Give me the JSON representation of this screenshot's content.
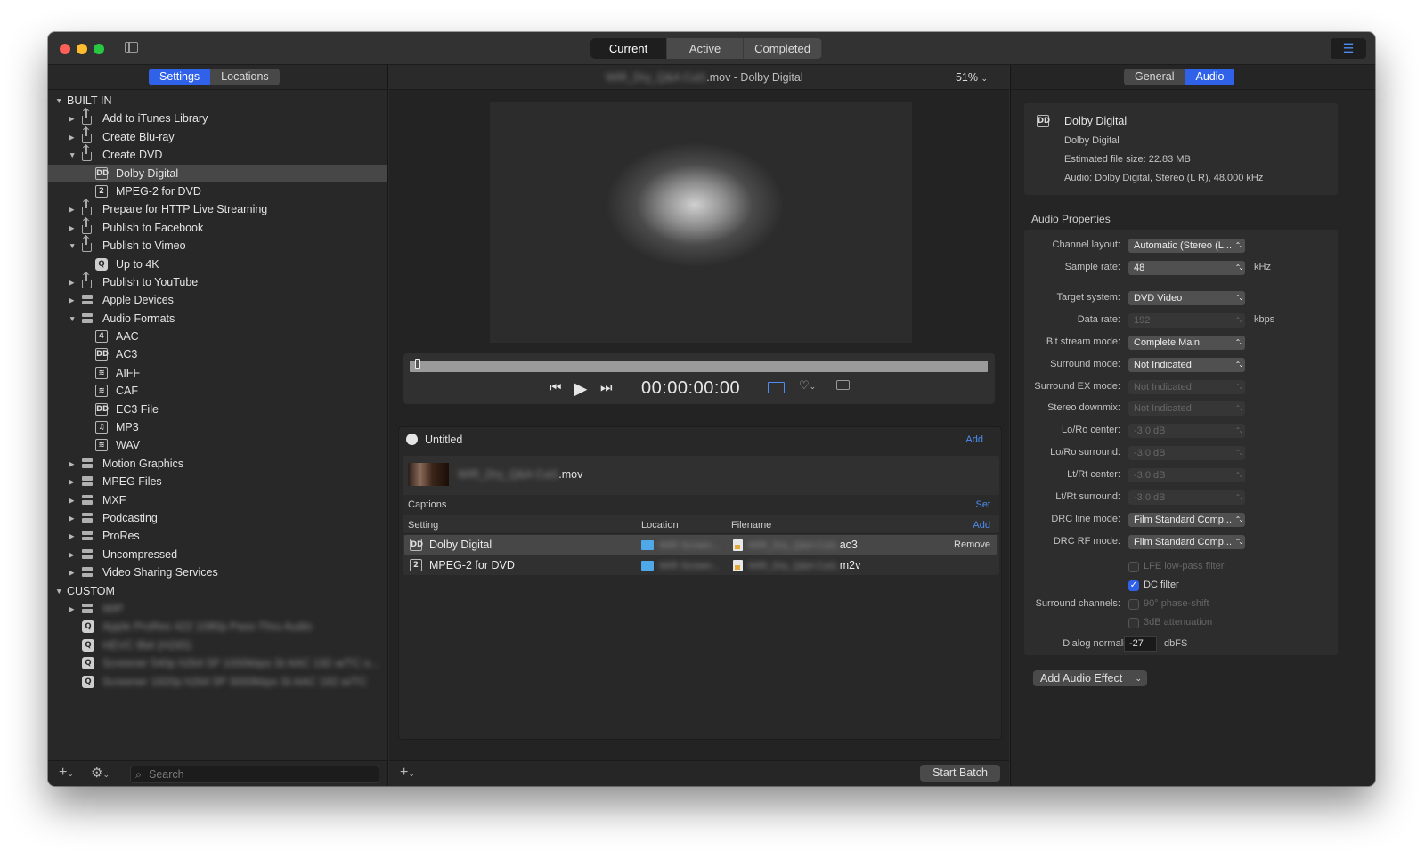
{
  "window": {
    "tabs": [
      "Current",
      "Active",
      "Completed"
    ],
    "active_tab": "Current"
  },
  "left": {
    "tabs": [
      "Settings",
      "Locations"
    ],
    "sections": [
      {
        "name": "BUILT-IN"
      },
      {
        "name": "CUSTOM"
      }
    ],
    "items": [
      {
        "label": "Add to iTunes Library",
        "icon": "share-icon",
        "tri": "▶"
      },
      {
        "label": "Create Blu-ray",
        "icon": "share-icon",
        "tri": "▶"
      },
      {
        "label": "Create DVD",
        "icon": "share-icon",
        "tri": "▼"
      },
      {
        "label": "Dolby Digital",
        "icon": "DD",
        "selected": true
      },
      {
        "label": "MPEG-2 for DVD",
        "icon": "2"
      },
      {
        "label": "Prepare for HTTP Live Streaming",
        "icon": "share-icon",
        "tri": "▶"
      },
      {
        "label": "Publish to Facebook",
        "icon": "share-icon",
        "tri": "▶"
      },
      {
        "label": "Publish to Vimeo",
        "icon": "share-icon",
        "tri": "▼"
      },
      {
        "label": "Up to 4K",
        "icon": "Q"
      },
      {
        "label": "Publish to YouTube",
        "icon": "share-icon",
        "tri": "▶"
      },
      {
        "label": "Apple Devices",
        "icon": "group-icon",
        "tri": "▶"
      },
      {
        "label": "Audio Formats",
        "icon": "group-icon",
        "tri": "▼"
      },
      {
        "label": "AAC",
        "icon": "4"
      },
      {
        "label": "AC3",
        "icon": "DD"
      },
      {
        "label": "AIFF",
        "icon": "wave"
      },
      {
        "label": "CAF",
        "icon": "wave"
      },
      {
        "label": "EC3 File",
        "icon": "DD"
      },
      {
        "label": "MP3",
        "icon": "♫"
      },
      {
        "label": "WAV",
        "icon": "wave"
      },
      {
        "label": "Motion Graphics",
        "icon": "group-icon",
        "tri": "▶"
      },
      {
        "label": "MPEG Files",
        "icon": "group-icon",
        "tri": "▶"
      },
      {
        "label": "MXF",
        "icon": "group-icon",
        "tri": "▶"
      },
      {
        "label": "Podcasting",
        "icon": "group-icon",
        "tri": "▶"
      },
      {
        "label": "ProRes",
        "icon": "group-icon",
        "tri": "▶"
      },
      {
        "label": "Uncompressed",
        "icon": "group-icon",
        "tri": "▶"
      },
      {
        "label": "Video Sharing Services",
        "icon": "group-icon",
        "tri": "▶"
      }
    ],
    "custom_items": [
      {
        "label": "WIP",
        "icon": "group-icon",
        "tri": "▶"
      },
      {
        "label": "Apple ProRes 422 1080p Pass-Thru Audio",
        "icon": "Q"
      },
      {
        "label": "HEVC 8bit (H265)",
        "icon": "Q"
      },
      {
        "label": "Screener 540p h264 5P 1000kbps St AAC 192 w/TC o...",
        "icon": "Q"
      },
      {
        "label": "Screener 1920p h264 5P 3000kbps St AAC 192 w/TC",
        "icon": "Q"
      }
    ],
    "search_placeholder": "Search"
  },
  "center": {
    "title_blurred": "WIR_Dry_Q&A Cut1",
    "title_suffix": ".mov - Dolby Digital",
    "zoom": "51%",
    "timecode": "00:00:00:00",
    "batch_title": "Untitled",
    "add_label": "Add",
    "file_blurred": "WIR_Dry_Q&A Cut1",
    "file_suffix": ".mov",
    "captions_label": "Captions",
    "set_label": "Set",
    "columns": [
      "Setting",
      "Location",
      "Filename"
    ],
    "col_add": "Add",
    "outputs": [
      {
        "setting": "Dolby Digital",
        "icon": "DD",
        "location": "WIR Screen...",
        "filename_blurred": "WIR_Dry_Q&A Cut1.",
        "ext": "ac3",
        "action": "Remove",
        "selected": true
      },
      {
        "setting": "MPEG-2 for DVD",
        "icon": "2",
        "location": "WIR Screen...",
        "filename_blurred": "WIR_Dry_Q&A Cut1.",
        "ext": "m2v",
        "action": "",
        "selected": false
      }
    ],
    "start_batch": "Start Batch"
  },
  "right": {
    "tabs": [
      "General",
      "Audio"
    ],
    "active_tab": "Audio",
    "summary": {
      "title": "Dolby Digital",
      "subtitle": "Dolby Digital",
      "size": "Estimated file size: 22.83 MB",
      "audio": "Audio: Dolby Digital, Stereo (L R), 48.000 kHz"
    },
    "section_title": "Audio Properties",
    "props": [
      {
        "label": "Channel layout:",
        "value": "Automatic (Stereo (L...",
        "unit": "",
        "disabled": false
      },
      {
        "label": "Sample rate:",
        "value": "48",
        "unit": "kHz",
        "disabled": false
      },
      {
        "label": "Target system:",
        "value": "DVD Video",
        "unit": "",
        "disabled": false
      },
      {
        "label": "Data rate:",
        "value": "192",
        "unit": "kbps",
        "disabled": true
      },
      {
        "label": "Bit stream mode:",
        "value": "Complete Main",
        "unit": "",
        "disabled": false
      },
      {
        "label": "Surround mode:",
        "value": "Not Indicated",
        "unit": "",
        "disabled": false
      },
      {
        "label": "Surround EX mode:",
        "value": "Not Indicated",
        "unit": "",
        "disabled": true
      },
      {
        "label": "Stereo downmix:",
        "value": "Not Indicated",
        "unit": "",
        "disabled": true
      },
      {
        "label": "Lo/Ro center:",
        "value": "-3.0 dB",
        "unit": "",
        "disabled": true
      },
      {
        "label": "Lo/Ro surround:",
        "value": "-3.0 dB",
        "unit": "",
        "disabled": true
      },
      {
        "label": "Lt/Rt center:",
        "value": "-3.0 dB",
        "unit": "",
        "disabled": true
      },
      {
        "label": "Lt/Rt surround:",
        "value": "-3.0 dB",
        "unit": "",
        "disabled": true
      },
      {
        "label": "DRC line mode:",
        "value": "Film Standard Comp...",
        "unit": "",
        "disabled": false
      },
      {
        "label": "DRC RF mode:",
        "value": "Film Standard Comp...",
        "unit": "",
        "disabled": false
      }
    ],
    "lfe": "LFE low-pass filter",
    "dc": "DC filter",
    "surround_channels_label": "Surround channels:",
    "phase": "90° phase-shift",
    "atten": "3dB attenuation",
    "dialog_label": "Dialog normalization:",
    "dialog_value": "-27",
    "dialog_unit": "dbFS",
    "add_effect": "Add Audio Effect"
  },
  "colors": {
    "accent": "#2f62e8",
    "window_bg": "#2b2b2b",
    "selection": "#474747"
  }
}
